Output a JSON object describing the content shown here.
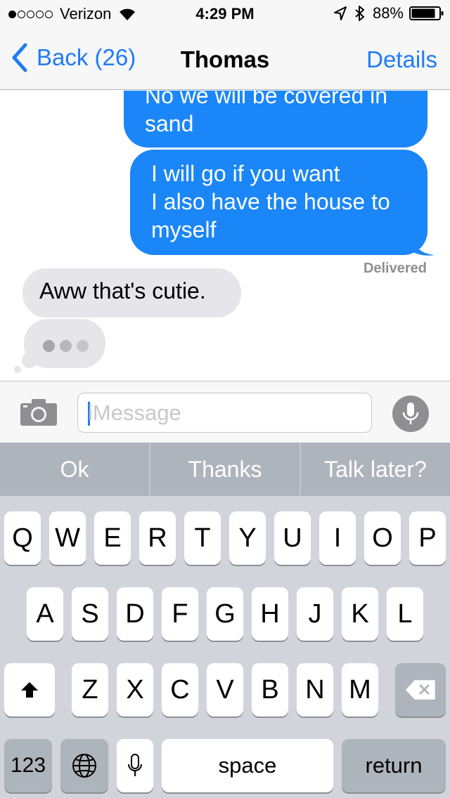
{
  "status_bar": {
    "signal_dots_filled": 1,
    "signal_dots_total": 5,
    "carrier": "Verizon",
    "time": "4:29 PM",
    "battery": "88%"
  },
  "nav": {
    "back_label": "Back (26)",
    "title": "Thomas",
    "details_label": "Details"
  },
  "messages": [
    {
      "from": "me",
      "text": "No we will be covered in sand"
    },
    {
      "from": "me",
      "lines": [
        "I will go if you want",
        "I also have the house to",
        "myself"
      ]
    },
    {
      "from": "them",
      "text": "Aww that's cutie."
    }
  ],
  "delivered_label": "Delivered",
  "input": {
    "placeholder": "iMessage"
  },
  "suggestions": [
    "Ok",
    "Thanks",
    "Talk later?"
  ],
  "keyboard": {
    "row1": [
      "Q",
      "W",
      "E",
      "R",
      "T",
      "Y",
      "U",
      "I",
      "O",
      "P"
    ],
    "row2": [
      "A",
      "S",
      "D",
      "F",
      "G",
      "H",
      "J",
      "K",
      "L"
    ],
    "row3": [
      "Z",
      "X",
      "C",
      "V",
      "B",
      "N",
      "M"
    ],
    "numbers_label": "123",
    "space_label": "space",
    "return_label": "return"
  },
  "colors": {
    "accent": "#1e7cf5",
    "outgoing_bubble": "#1b86f7",
    "incoming_bubble": "#e5e5ea",
    "keyboard_bg": "#d1d5db"
  },
  "icons": {
    "back": "chevron-left-icon",
    "camera": "camera-icon",
    "mic": "microphone-icon",
    "shift": "shift-arrow-icon",
    "delete": "backspace-icon",
    "globe": "globe-icon",
    "dictation": "dictation-mic-icon",
    "wifi": "wifi-icon",
    "location": "location-arrow-icon",
    "bluetooth": "bluetooth-icon",
    "battery": "battery-icon"
  }
}
